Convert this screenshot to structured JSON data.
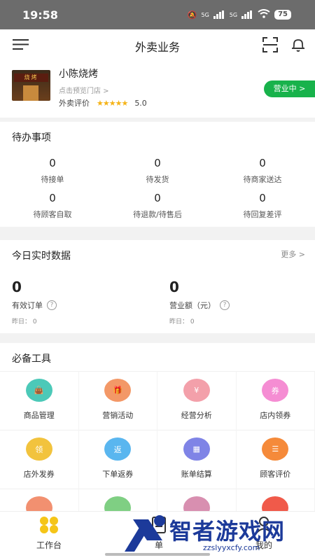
{
  "status_bar": {
    "time": "19:58",
    "signal1": "5G",
    "signal2": "5G",
    "battery": "75"
  },
  "header": {
    "title": "外卖业务"
  },
  "store": {
    "name": "小陈烧烤",
    "preview": "点击预览门店 >",
    "rating_label": "外卖评价",
    "stars": "★★★★★",
    "rating": "5.0",
    "status_button": "营业中 >",
    "sign_text": "烧烤"
  },
  "todo": {
    "title": "待办事项",
    "items": [
      {
        "value": "0",
        "label": "待接单"
      },
      {
        "value": "0",
        "label": "待发货"
      },
      {
        "value": "0",
        "label": "待商家送达"
      },
      {
        "value": "0",
        "label": "待顾客自取"
      },
      {
        "value": "0",
        "label": "待退款/待售后"
      },
      {
        "value": "0",
        "label": "待回复差评"
      }
    ]
  },
  "today": {
    "title": "今日实时数据",
    "more": "更多 >",
    "stats": [
      {
        "value": "0",
        "label": "有效订单",
        "yesterday": "昨日： 0"
      },
      {
        "value": "0",
        "label": "营业额（元）",
        "yesterday": "昨日： 0"
      }
    ]
  },
  "tools": {
    "title": "必备工具",
    "items": [
      {
        "label": "商品管理",
        "icon": "bag-icon",
        "glyph": "👜",
        "color": "#4cc9b8"
      },
      {
        "label": "营销活动",
        "icon": "gift-icon",
        "glyph": "🎁",
        "color": "#f39867"
      },
      {
        "label": "经营分析",
        "icon": "yen-icon",
        "glyph": "¥",
        "color": "#f3a0aa"
      },
      {
        "label": "店内领券",
        "icon": "coupon-icon",
        "glyph": "券",
        "color": "#f58dd3"
      },
      {
        "label": "店外发券",
        "icon": "coupon-out-icon",
        "glyph": "领",
        "color": "#f2c33d"
      },
      {
        "label": "下单返券",
        "icon": "return-coupon-icon",
        "glyph": "返",
        "color": "#5ab6ef"
      },
      {
        "label": "账单结算",
        "icon": "calculator-icon",
        "glyph": "▦",
        "color": "#7f84e6"
      },
      {
        "label": "顾客评价",
        "icon": "comment-icon",
        "glyph": "☰",
        "color": "#f58a3a"
      },
      {
        "label": "",
        "icon": "camera-icon",
        "glyph": "",
        "color": "#f29070"
      },
      {
        "label": "",
        "icon": "box-icon",
        "glyph": "",
        "color": "#7fcf83"
      },
      {
        "label": "",
        "icon": "mic-icon",
        "glyph": "",
        "color": "#d88fb0"
      },
      {
        "label": "",
        "icon": "rocket-icon",
        "glyph": "",
        "color": "#f05a4a"
      }
    ]
  },
  "tabbar": {
    "tabs": [
      {
        "label": "工作台",
        "icon": "workbench-icon"
      },
      {
        "label": "单",
        "icon": "orders-icon"
      },
      {
        "label": "我的",
        "icon": "profile-icon"
      }
    ]
  },
  "watermark": {
    "text": "智者游戏网",
    "url": "zzslyyxcfy.com"
  }
}
